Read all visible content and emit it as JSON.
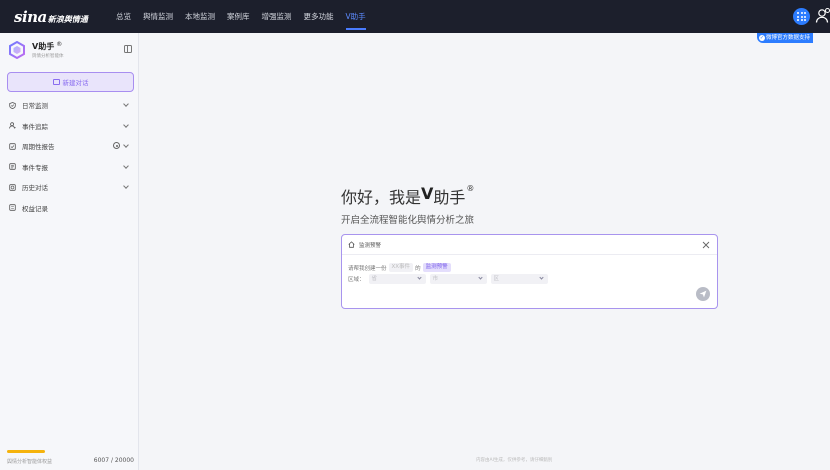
{
  "header": {
    "logo_text": "sina",
    "logo_sub": "新浪舆情通",
    "nav": [
      "总览",
      "舆情监测",
      "本地监测",
      "案例库",
      "增强监测",
      "更多功能",
      "V助手"
    ],
    "active_nav": "V助手",
    "support_badge": "微博官方数据支持",
    "accent_color": "#4a7cff"
  },
  "sidebar": {
    "brand_name": "V助手",
    "brand_mark": "®",
    "brand_sub": "舆情分析智能体",
    "new_chat_label": "新建对话",
    "menu": [
      {
        "label": "日常监测",
        "icon": "shield-icon"
      },
      {
        "label": "事件追踪",
        "icon": "user-track-icon"
      },
      {
        "label": "周期性报告",
        "icon": "report-icon"
      },
      {
        "label": "事件专报",
        "icon": "document-icon"
      },
      {
        "label": "历史对话",
        "icon": "history-icon"
      },
      {
        "label": "权益记录",
        "icon": "record-icon"
      }
    ],
    "quota_label": "舆情分析智能体权益",
    "quota_value": "6007 / 20000",
    "quota_fraction": 0.30035,
    "quota_color": "#f5b30d"
  },
  "main": {
    "greeting_prefix": "你好，我是",
    "greeting_name": "V",
    "greeting_suffix": "助手",
    "greeting_mark": "®",
    "subtitle": "开启全流程智能化舆情分析之旅",
    "card": {
      "title": "监测预警",
      "line_prefix": "请帮我创建一份",
      "placeholder_chip": "XX事件",
      "line_mid": "的",
      "tag": "监测预警",
      "region_label": "区域：",
      "selects": [
        "省",
        "市",
        "区"
      ]
    },
    "footer_note": "内容由AI生成，仅供参考，请仔细甄别"
  }
}
